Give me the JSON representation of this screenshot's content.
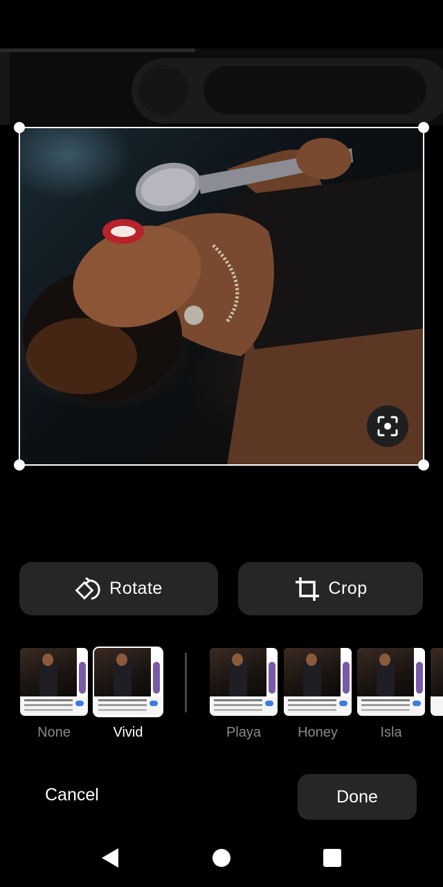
{
  "editor": {
    "actions": {
      "rotate_label": "Rotate",
      "crop_label": "Crop"
    },
    "filters": [
      {
        "label": "None",
        "selected": false
      },
      {
        "label": "Vivid",
        "selected": true
      },
      {
        "label": "Playa",
        "selected": false
      },
      {
        "label": "Honey",
        "selected": false
      },
      {
        "label": "Isla",
        "selected": false
      }
    ],
    "cancel_label": "Cancel",
    "done_label": "Done"
  },
  "icons": {
    "rotate": "rotate-icon",
    "crop": "crop-icon",
    "lens": "lens-icon",
    "back": "back-icon",
    "home": "home-icon",
    "recents": "recents-icon"
  },
  "colors": {
    "background": "#000000",
    "button": "#262626",
    "selected_text": "#ffffff",
    "muted_text": "#8a8a8a"
  }
}
